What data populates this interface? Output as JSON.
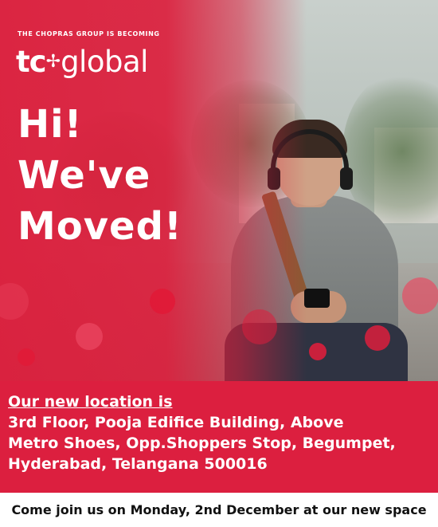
{
  "brand": {
    "tagline": "THE CHOPRAS GROUP IS BECOMING",
    "logo_tc": "tc",
    "logo_mark": "✢",
    "logo_global": "global"
  },
  "headline": {
    "line1": "Hi!",
    "line2": "We've",
    "line3": "Moved!"
  },
  "address": {
    "title": "Our new location is",
    "lines": [
      "3rd Floor, Pooja Edifice Building, Above",
      "Metro Shoes, Opp.Shoppers Stop, Begumpet,",
      "Hyderabad, Telangana 500016"
    ]
  },
  "footer": {
    "text": "Come join us on Monday, 2nd December at our new space"
  },
  "colors": {
    "brand_red": "#dc1f3f",
    "text_light": "#ffffff",
    "text_dark": "#111111"
  }
}
